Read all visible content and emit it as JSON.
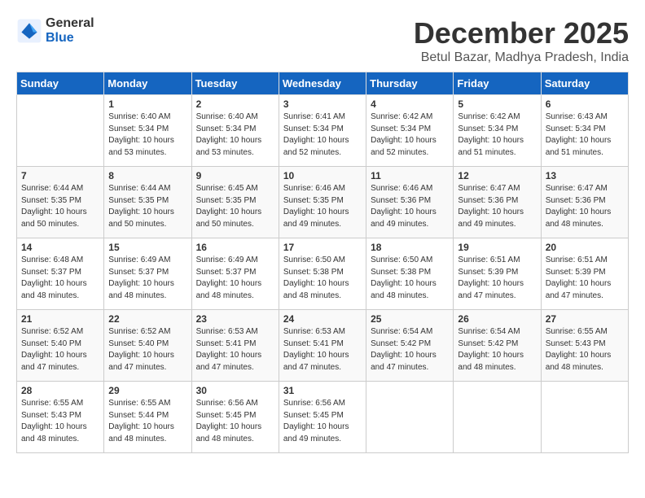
{
  "header": {
    "logo_general": "General",
    "logo_blue": "Blue",
    "month_title": "December 2025",
    "location": "Betul Bazar, Madhya Pradesh, India"
  },
  "days_of_week": [
    "Sunday",
    "Monday",
    "Tuesday",
    "Wednesday",
    "Thursday",
    "Friday",
    "Saturday"
  ],
  "weeks": [
    [
      {
        "day": "",
        "info": ""
      },
      {
        "day": "1",
        "info": "Sunrise: 6:40 AM\nSunset: 5:34 PM\nDaylight: 10 hours\nand 53 minutes."
      },
      {
        "day": "2",
        "info": "Sunrise: 6:40 AM\nSunset: 5:34 PM\nDaylight: 10 hours\nand 53 minutes."
      },
      {
        "day": "3",
        "info": "Sunrise: 6:41 AM\nSunset: 5:34 PM\nDaylight: 10 hours\nand 52 minutes."
      },
      {
        "day": "4",
        "info": "Sunrise: 6:42 AM\nSunset: 5:34 PM\nDaylight: 10 hours\nand 52 minutes."
      },
      {
        "day": "5",
        "info": "Sunrise: 6:42 AM\nSunset: 5:34 PM\nDaylight: 10 hours\nand 51 minutes."
      },
      {
        "day": "6",
        "info": "Sunrise: 6:43 AM\nSunset: 5:34 PM\nDaylight: 10 hours\nand 51 minutes."
      }
    ],
    [
      {
        "day": "7",
        "info": "Sunrise: 6:44 AM\nSunset: 5:35 PM\nDaylight: 10 hours\nand 50 minutes."
      },
      {
        "day": "8",
        "info": "Sunrise: 6:44 AM\nSunset: 5:35 PM\nDaylight: 10 hours\nand 50 minutes."
      },
      {
        "day": "9",
        "info": "Sunrise: 6:45 AM\nSunset: 5:35 PM\nDaylight: 10 hours\nand 50 minutes."
      },
      {
        "day": "10",
        "info": "Sunrise: 6:46 AM\nSunset: 5:35 PM\nDaylight: 10 hours\nand 49 minutes."
      },
      {
        "day": "11",
        "info": "Sunrise: 6:46 AM\nSunset: 5:36 PM\nDaylight: 10 hours\nand 49 minutes."
      },
      {
        "day": "12",
        "info": "Sunrise: 6:47 AM\nSunset: 5:36 PM\nDaylight: 10 hours\nand 49 minutes."
      },
      {
        "day": "13",
        "info": "Sunrise: 6:47 AM\nSunset: 5:36 PM\nDaylight: 10 hours\nand 48 minutes."
      }
    ],
    [
      {
        "day": "14",
        "info": "Sunrise: 6:48 AM\nSunset: 5:37 PM\nDaylight: 10 hours\nand 48 minutes."
      },
      {
        "day": "15",
        "info": "Sunrise: 6:49 AM\nSunset: 5:37 PM\nDaylight: 10 hours\nand 48 minutes."
      },
      {
        "day": "16",
        "info": "Sunrise: 6:49 AM\nSunset: 5:37 PM\nDaylight: 10 hours\nand 48 minutes."
      },
      {
        "day": "17",
        "info": "Sunrise: 6:50 AM\nSunset: 5:38 PM\nDaylight: 10 hours\nand 48 minutes."
      },
      {
        "day": "18",
        "info": "Sunrise: 6:50 AM\nSunset: 5:38 PM\nDaylight: 10 hours\nand 48 minutes."
      },
      {
        "day": "19",
        "info": "Sunrise: 6:51 AM\nSunset: 5:39 PM\nDaylight: 10 hours\nand 47 minutes."
      },
      {
        "day": "20",
        "info": "Sunrise: 6:51 AM\nSunset: 5:39 PM\nDaylight: 10 hours\nand 47 minutes."
      }
    ],
    [
      {
        "day": "21",
        "info": "Sunrise: 6:52 AM\nSunset: 5:40 PM\nDaylight: 10 hours\nand 47 minutes."
      },
      {
        "day": "22",
        "info": "Sunrise: 6:52 AM\nSunset: 5:40 PM\nDaylight: 10 hours\nand 47 minutes."
      },
      {
        "day": "23",
        "info": "Sunrise: 6:53 AM\nSunset: 5:41 PM\nDaylight: 10 hours\nand 47 minutes."
      },
      {
        "day": "24",
        "info": "Sunrise: 6:53 AM\nSunset: 5:41 PM\nDaylight: 10 hours\nand 47 minutes."
      },
      {
        "day": "25",
        "info": "Sunrise: 6:54 AM\nSunset: 5:42 PM\nDaylight: 10 hours\nand 47 minutes."
      },
      {
        "day": "26",
        "info": "Sunrise: 6:54 AM\nSunset: 5:42 PM\nDaylight: 10 hours\nand 48 minutes."
      },
      {
        "day": "27",
        "info": "Sunrise: 6:55 AM\nSunset: 5:43 PM\nDaylight: 10 hours\nand 48 minutes."
      }
    ],
    [
      {
        "day": "28",
        "info": "Sunrise: 6:55 AM\nSunset: 5:43 PM\nDaylight: 10 hours\nand 48 minutes."
      },
      {
        "day": "29",
        "info": "Sunrise: 6:55 AM\nSunset: 5:44 PM\nDaylight: 10 hours\nand 48 minutes."
      },
      {
        "day": "30",
        "info": "Sunrise: 6:56 AM\nSunset: 5:45 PM\nDaylight: 10 hours\nand 48 minutes."
      },
      {
        "day": "31",
        "info": "Sunrise: 6:56 AM\nSunset: 5:45 PM\nDaylight: 10 hours\nand 49 minutes."
      },
      {
        "day": "",
        "info": ""
      },
      {
        "day": "",
        "info": ""
      },
      {
        "day": "",
        "info": ""
      }
    ]
  ]
}
